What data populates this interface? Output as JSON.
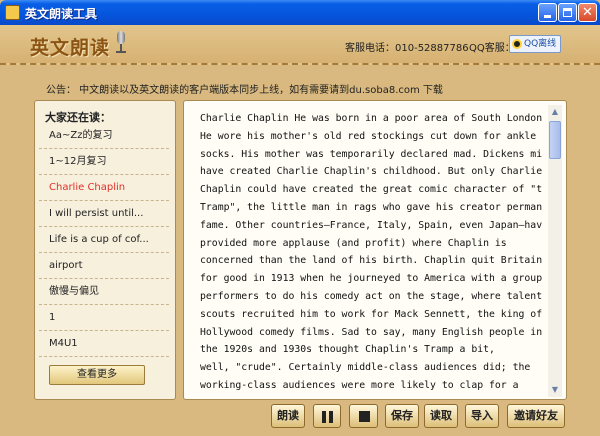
{
  "window": {
    "title": "英文朗读工具"
  },
  "header": {
    "logo": "英文朗读",
    "contact": "客服电话：010-52887786",
    "qq_label": "QQ客服：",
    "qq_button": "QQ离线"
  },
  "notice": "公告：  中文朗读以及英文朗读的客户端版本同步上线，如有需要请到du.soba8.com 下载",
  "sidebar": {
    "title": "大家还在读：",
    "items": [
      {
        "label": "Aa~Zz的复习",
        "active": false
      },
      {
        "label": "1~12月复习",
        "active": false
      },
      {
        "label": "Charlie Chaplin",
        "active": true
      },
      {
        "label": "I will persist until...",
        "active": false
      },
      {
        "label": "Life is a cup of cof...",
        "active": false
      },
      {
        "label": "airport",
        "active": false
      },
      {
        "label": "傲慢与偏见",
        "active": false
      },
      {
        "label": "1",
        "active": false
      },
      {
        "label": "M4U1",
        "active": false
      }
    ],
    "more_button": "查看更多"
  },
  "reader": {
    "text": "Charlie Chaplin He was born in a poor area of South London.\nHe wore his mother's old red stockings cut down for ankle\nsocks. His mother was temporarily declared mad. Dickens might\nhave created Charlie Chaplin's childhood. But only Charlie\nChaplin could have created the great comic character of \"the\nTramp\", the little man in rags who gave his creator permanent\nfame. Other countries—France, Italy, Spain, even Japan—have\nprovided more applause (and profit) where Chaplin is\nconcerned than the land of his birth. Chaplin quit Britain\nfor good in 1913 when he journeyed to America with a group of\nperformers to do his comedy act on the stage, where talent\nscouts recruited him to work for Mack Sennett, the king of\nHollywood comedy films. Sad to say, many English people in\nthe 1920s and 1930s thought Chaplin's Tramp a bit,\nwell, \"crude\". Certainly middle-class audiences did; the\nworking-class audiences were more likely to clap for a\ncharacter who revolted against authority, using his wicked\nlittle cane to trip it up, or aiming the heel of his boot for"
  },
  "toolbar": {
    "read": "朗读",
    "save": "保存",
    "fetch": "读取",
    "import": "导入",
    "invite": "邀请好友"
  },
  "colors": {
    "background": "#d9b97f",
    "title_bar": "#0555dc",
    "active_item": "#e0302a",
    "logo": "#8b5412"
  }
}
